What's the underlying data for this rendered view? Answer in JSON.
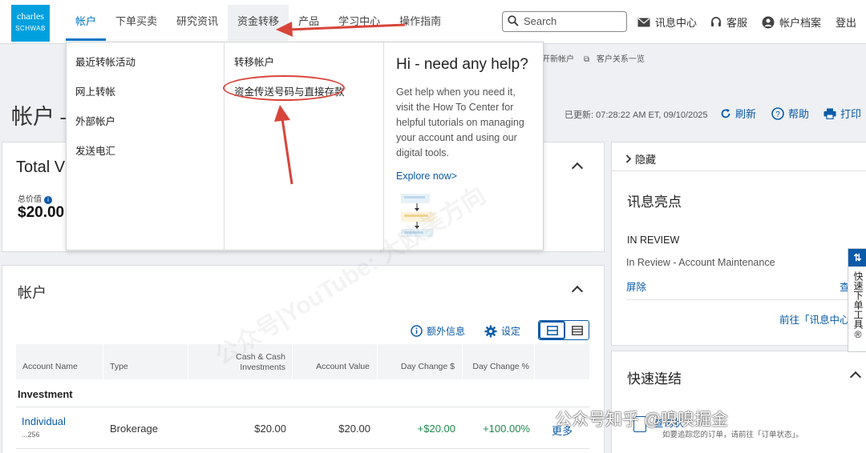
{
  "brand": {
    "line1": "charles",
    "line2": "SCHWAB"
  },
  "nav": [
    "帐户",
    "下单买卖",
    "研究资讯",
    "资金转移",
    "产品",
    "学习中心",
    "操作指南"
  ],
  "search": {
    "placeholder": "Search"
  },
  "utility": {
    "messages": "讯息中心",
    "service": "客服",
    "profile": "帐户档案",
    "logout": "登出"
  },
  "subline": {
    "open": "开新帐户",
    "relations": "客户关系一览"
  },
  "page": {
    "title": "帐户 –",
    "updated": "已更新: 07:28:22 AM ET, 09/10/2025",
    "refresh": "刷新",
    "help": "帮助",
    "print": "打印"
  },
  "total": {
    "title": "Total V",
    "label": "总价值",
    "value": "$20.00"
  },
  "accounts": {
    "title": "帐户",
    "info": "额外信息",
    "settings": "设定",
    "headers": [
      "Account Name",
      "Type",
      "Cash & Cash Investments",
      "Account Value",
      "Day Change $",
      "Day Change %"
    ],
    "group": "Investment",
    "row": {
      "name": "Individual",
      "num": "...256",
      "type": "Brokerage",
      "cash": "$20.00",
      "value": "$20.00",
      "chg": "+$20.00",
      "pct": "+100.00%",
      "more": "更多"
    }
  },
  "menu": {
    "col1": [
      "最近转帐活动",
      "网上转帐",
      "外部帐户",
      "发送电汇"
    ],
    "col2": [
      "转移帐户",
      "资金传送号码与直接存款"
    ],
    "help_title": "Hi - need any help?",
    "help_body": "Get help when you need it, visit the How To Center for helpful tutorials on managing your account and using our digital tools.",
    "help_link": "Explore now>"
  },
  "right_panel": {
    "hide": "隐藏",
    "title": "讯息亮点",
    "status": "IN REVIEW",
    "item": "In Review - Account Maintenance",
    "dismiss": "屏除",
    "view": "查",
    "goto": "前往「讯息中心」",
    "quick_links": "快速连结",
    "quick_item": "查询状",
    "quick_desc": "如要追踪您的订单，请前往「订单状态」。"
  },
  "quick_tool": "快速下单工具®",
  "watermark": "公众号知乎 @嗅嗅掘金",
  "diag_watermark": "公众号|YouTube: 大欧美方向"
}
